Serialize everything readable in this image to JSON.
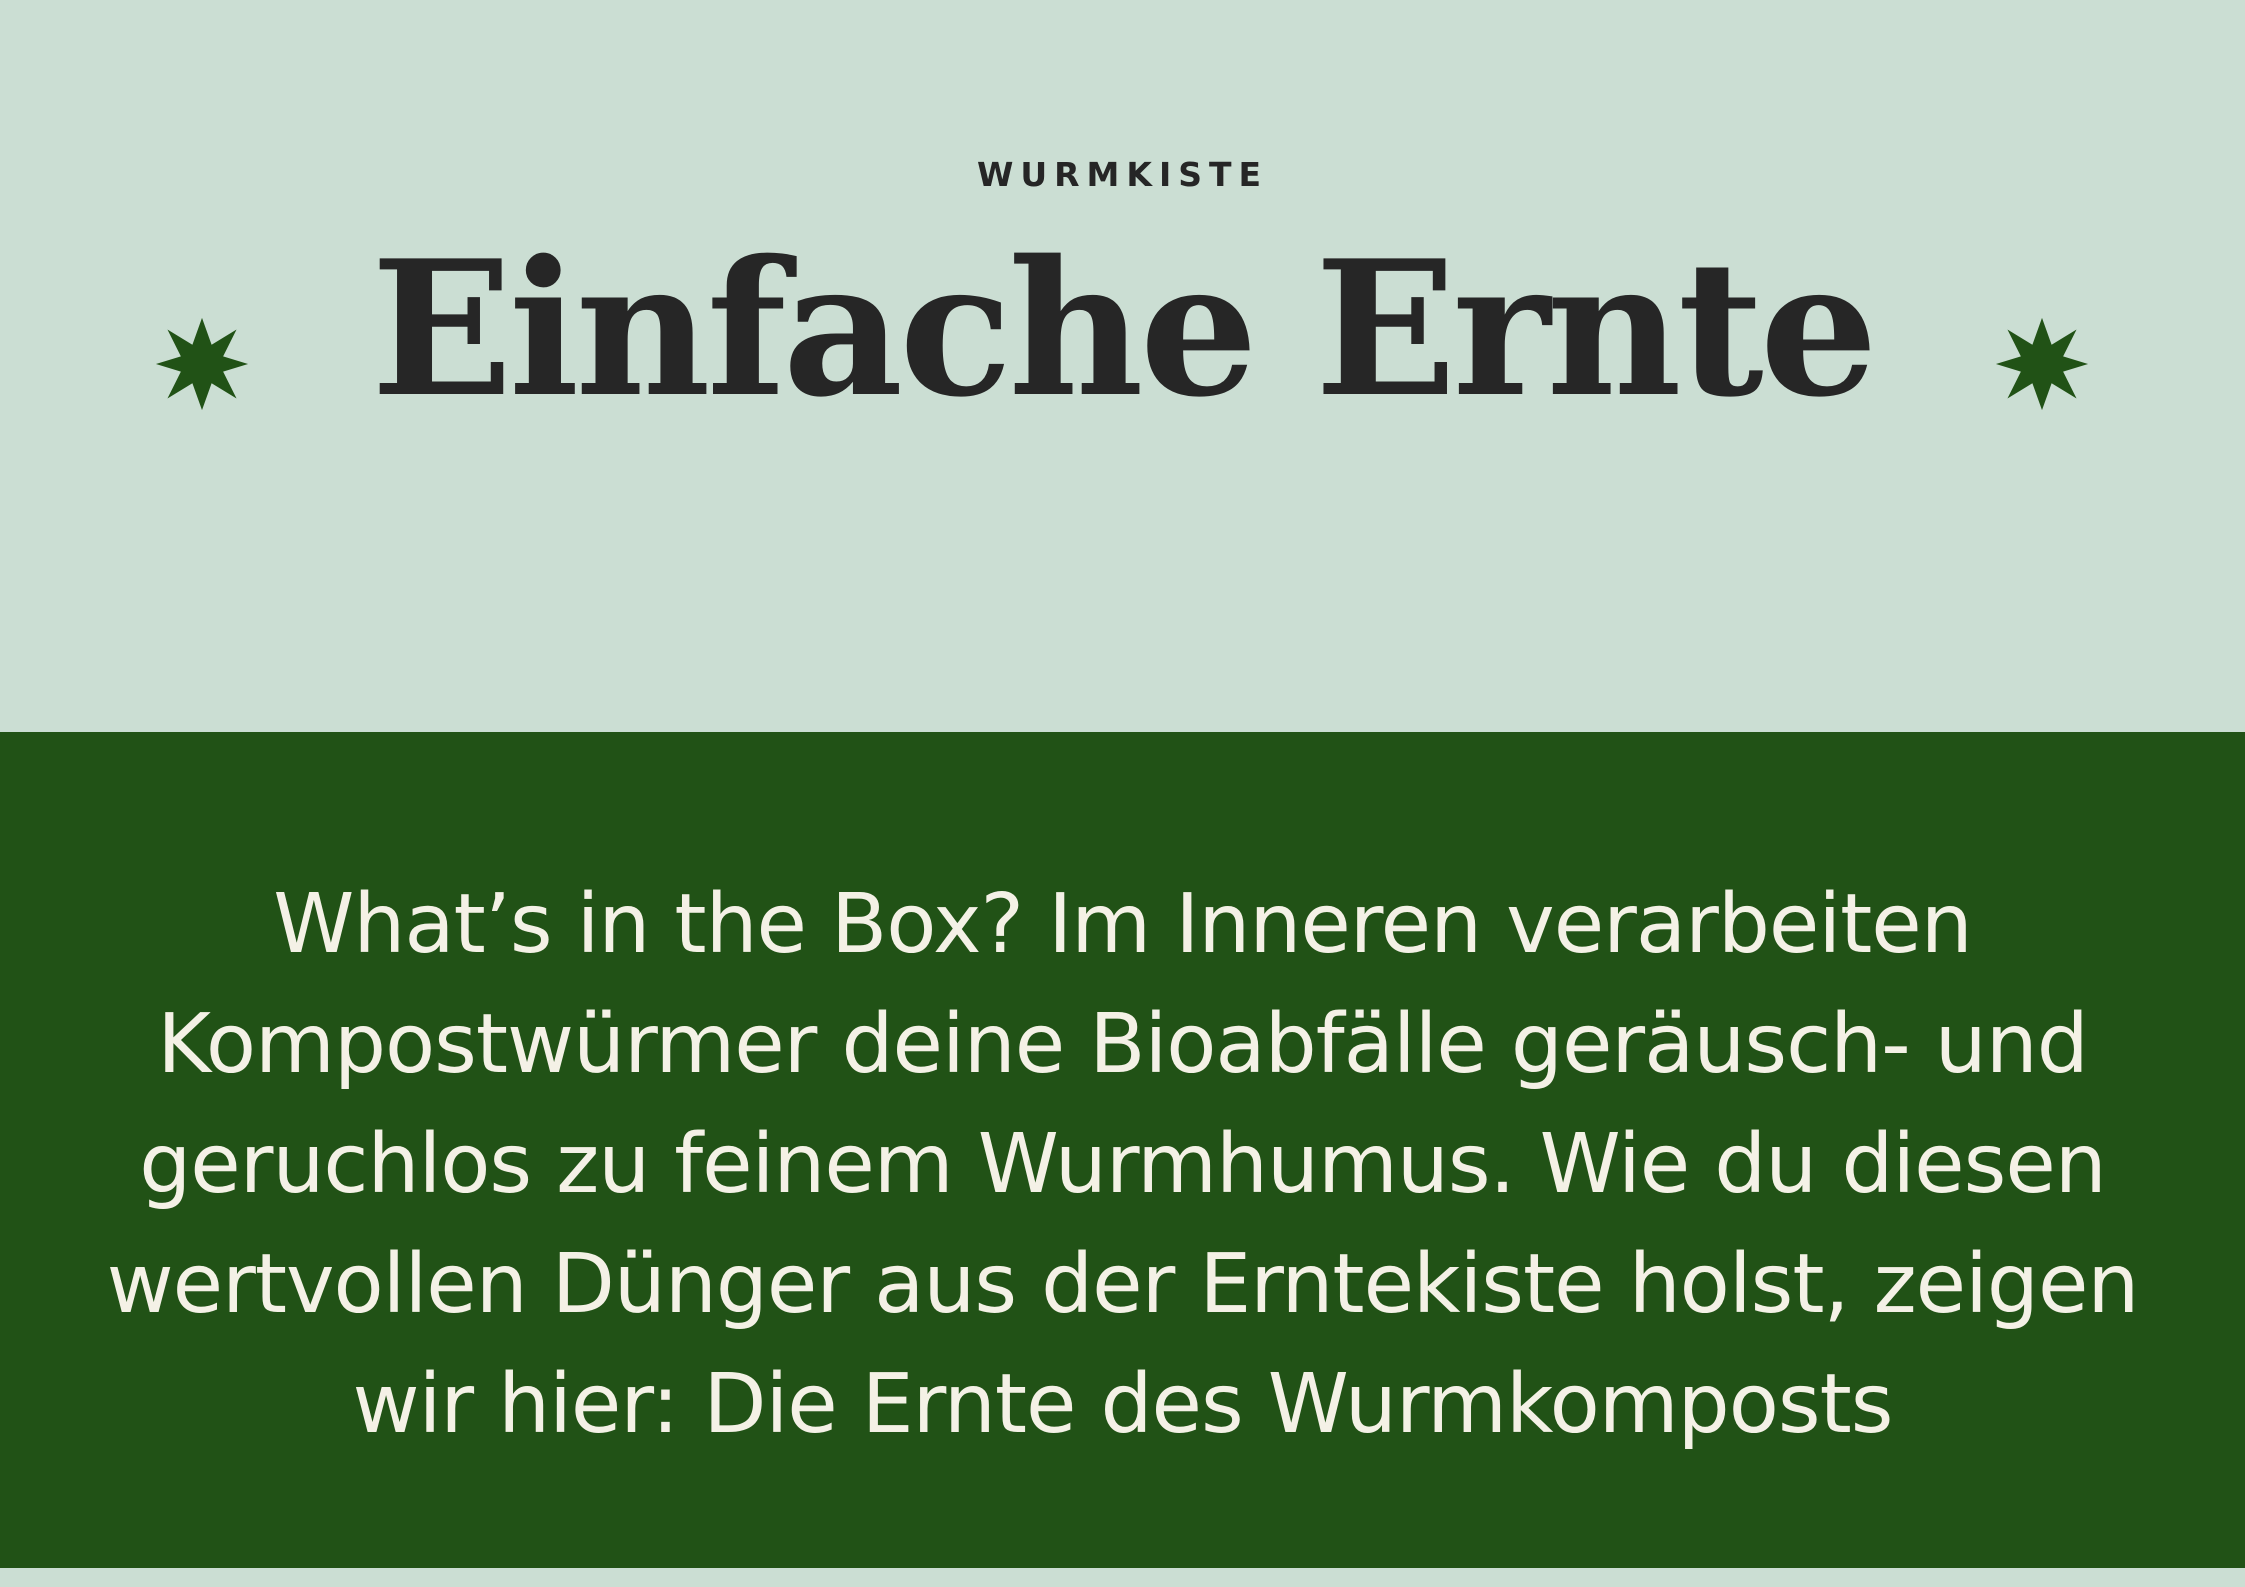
{
  "header": {
    "eyebrow": "WURMKISTE",
    "title": "Einfache Ernte",
    "decoration_icon": "star-burst-icon",
    "decoration_color": "#215216",
    "background_color": "#cbded3",
    "text_color": "#262626"
  },
  "panel": {
    "text": "What’s in the Box? Im Inneren verarbeiten Kompostwürmer deine Bioabfälle geräusch- und geruchlos zu feinem Wurmhumus. Wie du diesen wertvollen Dünger aus der Erntekiste holst, zeigen wir hier: Die Ernte des Wurmkomposts",
    "background_color": "#215216",
    "text_color": "#f4f1e6"
  }
}
